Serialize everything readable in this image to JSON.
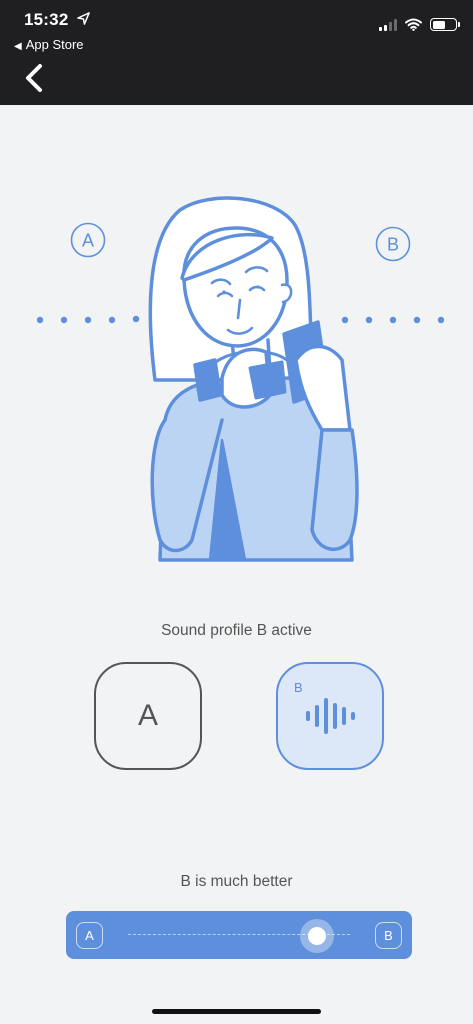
{
  "status_bar": {
    "time": "15:32",
    "back_app_label": "App Store",
    "location_icon": "location-arrow-icon",
    "signal_icon": "cellular-signal-icon",
    "wifi_icon": "wifi-icon",
    "battery_icon": "battery-icon",
    "battery_level": 0.55
  },
  "nav": {
    "back_icon": "chevron-left-icon"
  },
  "illustration": {
    "left_marker": "A",
    "right_marker": "B"
  },
  "profile_status": "Sound profile B active",
  "profiles": {
    "a_label": "A",
    "b_corner_label": "B",
    "b_icon": "sound-wave-icon",
    "active": "B"
  },
  "comparison": {
    "text": "B is much better",
    "left_label": "A",
    "right_label": "B",
    "value": 0.85
  },
  "colors": {
    "accent": "#5e8fdc",
    "accent_light": "#dce7f7",
    "status_bar_bg": "#1f1f21",
    "background": "#f2f3f5"
  }
}
